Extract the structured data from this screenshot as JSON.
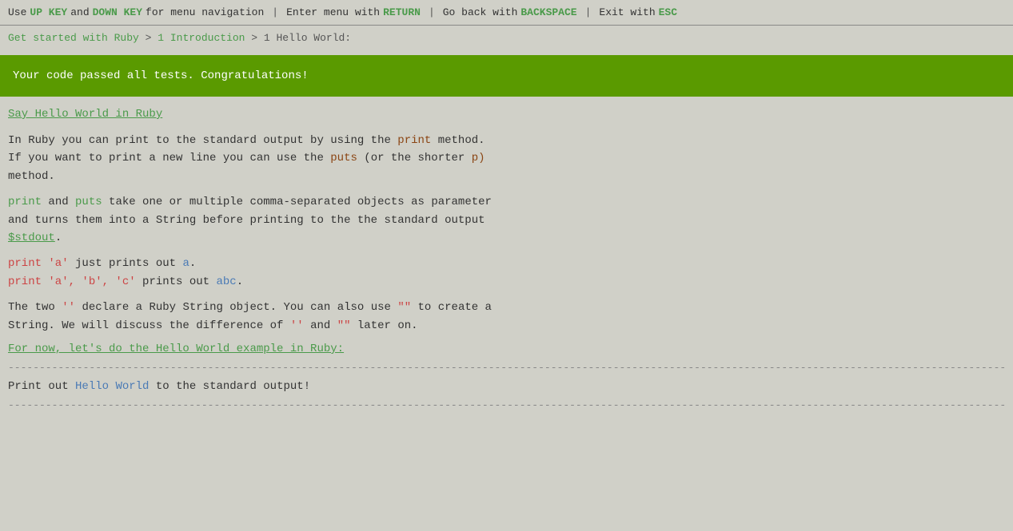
{
  "topbar": {
    "text1": "Use",
    "key_up": "UP KEY",
    "text2": "and",
    "key_down": "DOWN KEY",
    "text3": "for menu navigation",
    "sep1": "|",
    "text4": "Enter menu with",
    "key_return": "RETURN",
    "sep2": "|",
    "text5": "Go back with",
    "key_backspace": "BACKSPACE",
    "sep3": "|",
    "text6": "Exit with",
    "key_esc": "ESC"
  },
  "breadcrumb": {
    "link1": "Get started with Ruby",
    "sep1": ">",
    "link2": "1 Introduction",
    "sep2": ">",
    "current": "1 Hello World:"
  },
  "banner": {
    "message": "Your code passed all tests. Congratulations!"
  },
  "lesson": {
    "title": "Say Hello World in Ruby",
    "para1_pre": "In Ruby you can print to the standard output by using the",
    "para1_code": "print",
    "para1_post": "method.",
    "para2_pre": "If you want to print a new line you can use the",
    "para2_code1": "puts",
    "para2_mid": "(or the shorter",
    "para2_code2": "p)",
    "para2_post": "method.",
    "para3_code1": "print",
    "para3_mid1": "and",
    "para3_code2": "puts",
    "para3_rest": "take one or multiple comma-separated objects as parameter\nand turns them into a String before printing to the the standard output",
    "para3_var": "$stdout",
    "para3_dot": ".",
    "example1_code": "print 'a'",
    "example1_mid": "just prints out",
    "example1_val": "a",
    "example1_dot": ".",
    "example2_code": "print 'a', 'b', 'c'",
    "example2_mid": "prints out",
    "example2_val": "abc",
    "example2_dot": ".",
    "para4_pre": "The two",
    "para4_code1": "''",
    "para4_mid1": "declare a Ruby String object. You can also use",
    "para4_code2": "\"\"",
    "para4_mid2": "to create a\nString. We will discuss the difference of",
    "para4_code3": "''",
    "para4_mid3": "and",
    "para4_code4": "\"\"",
    "para4_post": "later on.",
    "link": "For now, let's do the Hello World example in Ruby:",
    "task_pre": "Print out",
    "task_code": "Hello World",
    "task_post": "to the standard output!"
  },
  "dashes": "----------------------------------------------------------------------------------------------------------------------------------------------------------------------------------------------------------------------------------------------------------------------------------------------------------------"
}
